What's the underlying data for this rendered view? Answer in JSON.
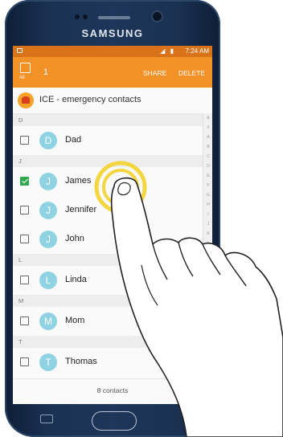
{
  "device": {
    "brand": "SAMSUNG"
  },
  "status_bar": {
    "time": "7:24 AM",
    "icons": "◢ ▮"
  },
  "action_bar": {
    "select_all_label": "All",
    "selected_count": "1",
    "share_label": "SHARE",
    "delete_label": "DELETE"
  },
  "ice": {
    "label": "ICE - emergency contacts"
  },
  "sections": [
    {
      "letter": "D",
      "contacts": [
        {
          "initial": "D",
          "name": "Dad",
          "checked": false
        }
      ]
    },
    {
      "letter": "J",
      "contacts": [
        {
          "initial": "J",
          "name": "James",
          "checked": true
        },
        {
          "initial": "J",
          "name": "Jennifer",
          "checked": false
        },
        {
          "initial": "J",
          "name": "John",
          "checked": false
        }
      ]
    },
    {
      "letter": "L",
      "contacts": [
        {
          "initial": "L",
          "name": "Linda",
          "checked": false
        }
      ]
    },
    {
      "letter": "M",
      "contacts": [
        {
          "initial": "M",
          "name": "Mom",
          "checked": false
        }
      ]
    },
    {
      "letter": "T",
      "contacts": [
        {
          "initial": "T",
          "name": "Thomas",
          "checked": false
        }
      ]
    }
  ],
  "index_letters": [
    "&",
    "#",
    "A",
    "B",
    "C",
    "D",
    "E",
    "F",
    "G",
    "H",
    "I",
    "J",
    "K",
    "L"
  ],
  "footer": {
    "count": "8 contacts"
  },
  "colors": {
    "status_bar": "#d8731a",
    "action_bar": "#f29126",
    "avatar": "#8fd3e3",
    "checkbox_checked": "#2fa84f",
    "tap_ring": "#f2d12b"
  }
}
